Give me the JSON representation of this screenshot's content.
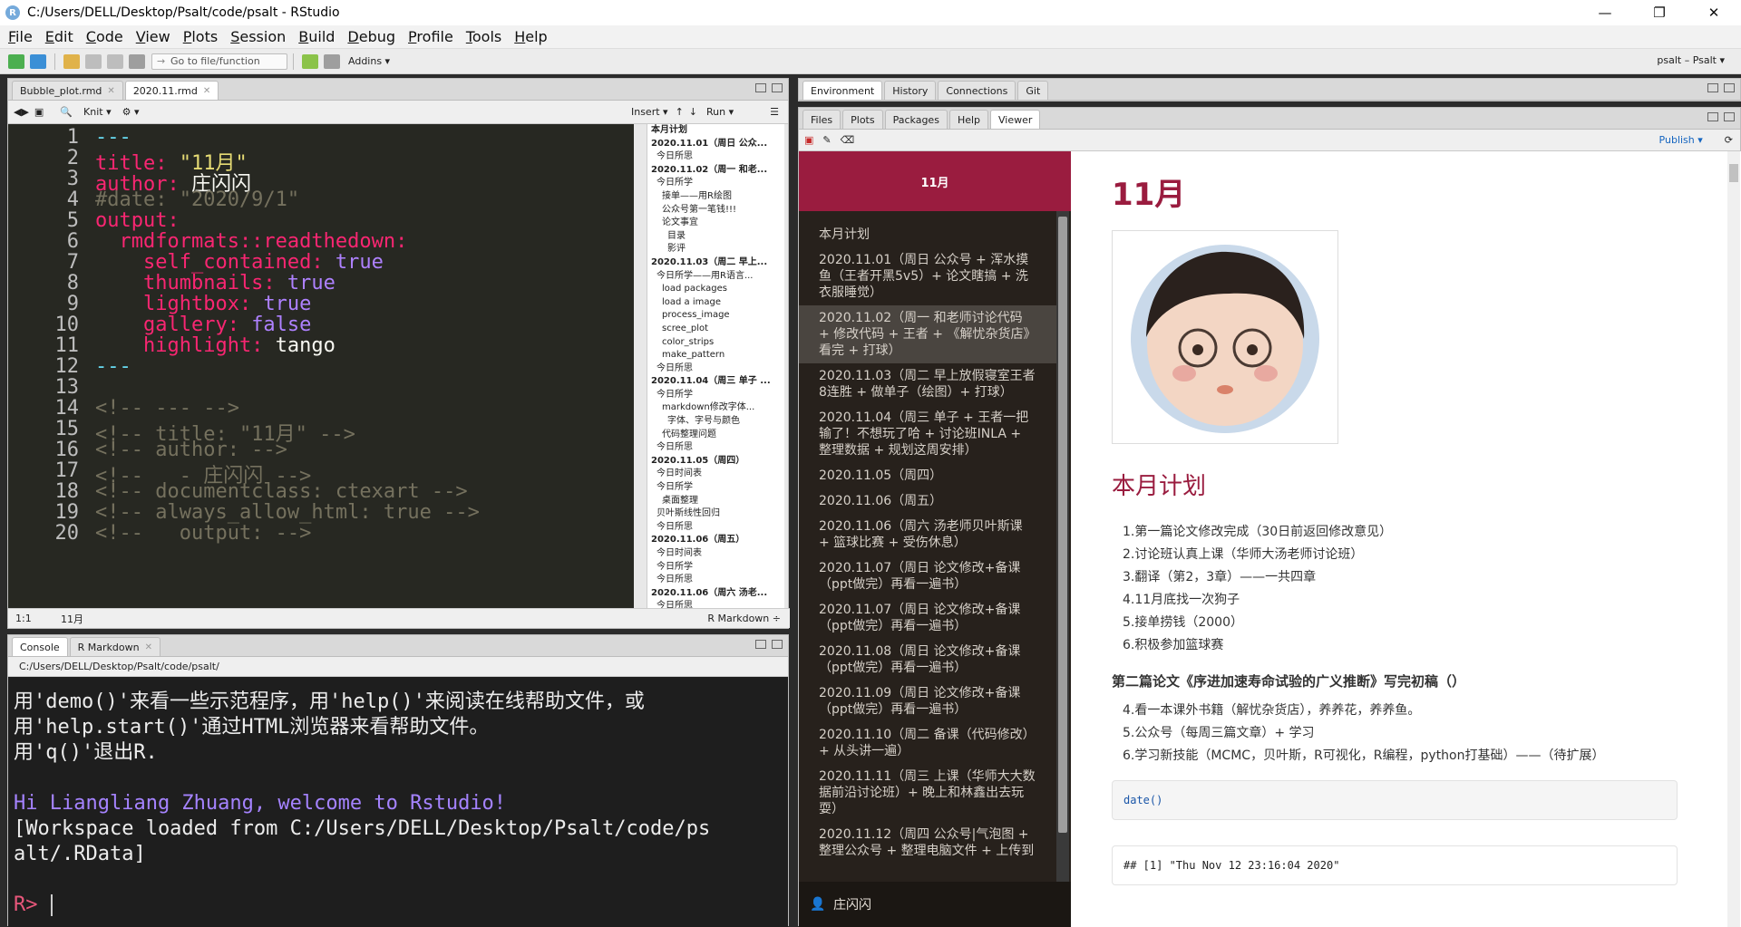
{
  "window": {
    "title": "C:/Users/DELL/Desktop/Psalt/code/psalt - RStudio",
    "controls": [
      "—",
      "❐",
      "✕"
    ]
  },
  "menu": [
    {
      "label": "File",
      "u": "F",
      "rest": "ile"
    },
    {
      "label": "Edit",
      "u": "E",
      "rest": "dit"
    },
    {
      "label": "Code",
      "u": "C",
      "rest": "ode"
    },
    {
      "label": "View",
      "u": "V",
      "rest": "iew"
    },
    {
      "label": "Plots",
      "u": "P",
      "rest": "lots"
    },
    {
      "label": "Session",
      "u": "S",
      "rest": "ession"
    },
    {
      "label": "Build",
      "u": "B",
      "rest": "uild"
    },
    {
      "label": "Debug",
      "u": "D",
      "rest": "ebug"
    },
    {
      "label": "Profile",
      "u": "P",
      "rest": "rofile"
    },
    {
      "label": "Tools",
      "u": "T",
      "rest": "ools"
    },
    {
      "label": "Help",
      "u": "H",
      "rest": "elp"
    }
  ],
  "toolbar": {
    "goto_placeholder": "Go to file/function",
    "addins": "Addins ▾",
    "project": "psalt – Psalt ▾"
  },
  "editor": {
    "tabs": [
      "Bubble_plot.rmd",
      "2020.11.rmd"
    ],
    "toolbar": {
      "knit": "Knit ▾",
      "insert": "Insert ▾",
      "run": "Run ▾"
    },
    "status": {
      "position": "1:1",
      "section": "11月",
      "mode": "R Markdown ÷"
    },
    "lines": [
      {
        "n": "1",
        "spans": [
          {
            "t": "---",
            "c": "#66d9ef"
          }
        ]
      },
      {
        "n": "2",
        "spans": [
          {
            "t": "title: ",
            "c": "#f92672"
          },
          {
            "t": "\"11月\"",
            "c": "#e6db74"
          }
        ]
      },
      {
        "n": "3",
        "spans": [
          {
            "t": "author: ",
            "c": "#f92672"
          },
          {
            "t": "庄闪闪",
            "c": "#f8f8f2"
          }
        ]
      },
      {
        "n": "4",
        "spans": [
          {
            "t": "#date: \"2020/9/1\"",
            "c": "#75715e"
          }
        ]
      },
      {
        "n": "5",
        "spans": [
          {
            "t": "output:",
            "c": "#f92672"
          }
        ]
      },
      {
        "n": "6",
        "spans": [
          {
            "t": "  rmdformats::readthedown:",
            "c": "#f92672"
          }
        ]
      },
      {
        "n": "7",
        "spans": [
          {
            "t": "    self_contained: ",
            "c": "#f92672"
          },
          {
            "t": "true",
            "c": "#ae81ff"
          }
        ]
      },
      {
        "n": "8",
        "spans": [
          {
            "t": "    thumbnails: ",
            "c": "#f92672"
          },
          {
            "t": "true",
            "c": "#ae81ff"
          }
        ]
      },
      {
        "n": "9",
        "spans": [
          {
            "t": "    lightbox: ",
            "c": "#f92672"
          },
          {
            "t": "true",
            "c": "#ae81ff"
          }
        ]
      },
      {
        "n": "10",
        "spans": [
          {
            "t": "    gallery: ",
            "c": "#f92672"
          },
          {
            "t": "false",
            "c": "#ae81ff"
          }
        ]
      },
      {
        "n": "11",
        "spans": [
          {
            "t": "    highlight: ",
            "c": "#f92672"
          },
          {
            "t": "tango",
            "c": "#f8f8f2"
          }
        ]
      },
      {
        "n": "12",
        "spans": [
          {
            "t": "---",
            "c": "#66d9ef"
          }
        ]
      },
      {
        "n": "13",
        "spans": []
      },
      {
        "n": "14",
        "spans": [
          {
            "t": "<!-- --- -->",
            "c": "#75715e"
          }
        ]
      },
      {
        "n": "15",
        "spans": [
          {
            "t": "<!-- title: \"11月\" -->",
            "c": "#75715e"
          }
        ]
      },
      {
        "n": "16",
        "spans": [
          {
            "t": "<!-- author: -->",
            "c": "#75715e"
          }
        ]
      },
      {
        "n": "17",
        "spans": [
          {
            "t": "<!--   - 庄闪闪 -->",
            "c": "#75715e"
          }
        ]
      },
      {
        "n": "18",
        "spans": [
          {
            "t": "<!-- documentclass: ctexart -->",
            "c": "#75715e"
          }
        ]
      },
      {
        "n": "19",
        "spans": [
          {
            "t": "<!-- always_allow_html: true -->",
            "c": "#75715e"
          }
        ]
      },
      {
        "n": "20",
        "spans": [
          {
            "t": "<!--   output: -->",
            "c": "#75715e"
          }
        ]
      }
    ],
    "outline": [
      {
        "t": "本月计划",
        "l": 0
      },
      {
        "t": "2020.11.01（周日 公众...",
        "l": 0
      },
      {
        "t": "今日所思",
        "l": 1
      },
      {
        "t": "2020.11.02（周一 和老...",
        "l": 0
      },
      {
        "t": "今日所学",
        "l": 1
      },
      {
        "t": "接单——用R绘图",
        "l": 2
      },
      {
        "t": "公众号第一笔钱!!!",
        "l": 2
      },
      {
        "t": "论文事宜",
        "l": 2
      },
      {
        "t": "目录",
        "l": 3
      },
      {
        "t": "影评",
        "l": 3
      },
      {
        "t": "2020.11.03（周二 早上...",
        "l": 0
      },
      {
        "t": "今日所学——用R语言...",
        "l": 1
      },
      {
        "t": "load packages",
        "l": 2
      },
      {
        "t": "load a image",
        "l": 2
      },
      {
        "t": "process_image",
        "l": 2
      },
      {
        "t": "scree_plot",
        "l": 2
      },
      {
        "t": "color_strips",
        "l": 2
      },
      {
        "t": "make_pattern",
        "l": 2
      },
      {
        "t": "今日所思",
        "l": 1
      },
      {
        "t": "2020.11.04（周三 单子 ...",
        "l": 0
      },
      {
        "t": "今日所学",
        "l": 1
      },
      {
        "t": "markdown修改字体...",
        "l": 2
      },
      {
        "t": "字体、字号与颜色",
        "l": 3
      },
      {
        "t": "代码整理问题",
        "l": 2
      },
      {
        "t": "今日所思",
        "l": 1
      },
      {
        "t": "2020.11.05（周四）",
        "l": 0
      },
      {
        "t": "今日时间表",
        "l": 1
      },
      {
        "t": "今日所学",
        "l": 1
      },
      {
        "t": "桌面整理",
        "l": 2
      },
      {
        "t": "贝叶斯线性回归",
        "l": 1
      },
      {
        "t": "今日所思",
        "l": 1
      },
      {
        "t": "2020.11.06（周五）",
        "l": 0
      },
      {
        "t": "今日时间表",
        "l": 1
      },
      {
        "t": "今日所学",
        "l": 1
      },
      {
        "t": "今日所思",
        "l": 1
      },
      {
        "t": "2020.11.06（周六 汤老...",
        "l": 0
      },
      {
        "t": "今日所思",
        "l": 1
      }
    ]
  },
  "console": {
    "tabs": [
      "Console",
      "R Markdown"
    ],
    "path": "C:/Users/DELL/Desktop/Psalt/code/psalt/",
    "lines": [
      {
        "t": "用'demo()'来看一些示范程序，用'help()'来阅读在线帮助文件，或",
        "c": "#ececec"
      },
      {
        "t": "用'help.start()'通过HTML浏览器来看帮助文件。",
        "c": "#ececec"
      },
      {
        "t": "用'q()'退出R.",
        "c": "#ececec"
      },
      {
        "t": " ",
        "c": "#ececec"
      },
      {
        "t": "Hi Liangliang Zhuang, welcome to Rstudio!",
        "c": "#a583ff"
      },
      {
        "t": "[Workspace loaded from C:/Users/DELL/Desktop/Psalt/code/ps",
        "c": "#ececec"
      },
      {
        "t": "alt/.RData]",
        "c": "#ececec"
      },
      {
        "t": " ",
        "c": "#ececec"
      }
    ],
    "prompt": "R>"
  },
  "env_tabs": [
    "Environment",
    "History",
    "Connections",
    "Git"
  ],
  "viewer": {
    "tabs": [
      "Files",
      "Plots",
      "Packages",
      "Help",
      "Viewer"
    ],
    "publish": "Publish ▾",
    "side_title": "11月",
    "nav": [
      "本月计划",
      "2020.11.01（周日 公众号 + 浑水摸鱼（王者开黑5v5）+ 论文瞎搞 + 洗衣服睡觉）",
      "2020.11.02（周一 和老师讨论代码 + 修改代码 + 王者 + 《解忧杂货店》看完 + 打球）",
      "2020.11.03（周二 早上放假寝室王者8连胜 + 做单子（绘图）+ 打球）",
      "2020.11.04（周三 单子 + 王者一把输了！不想玩了哈 + 讨论班INLA + 整理数据 + 规划这周安排）",
      "2020.11.05（周四）",
      "2020.11.06（周五）",
      "2020.11.06（周六 汤老师贝叶斯课 + 篮球比赛 + 受伤休息）",
      "2020.11.07（周日 论文修改+备课（ppt做完）再看一遍书）",
      "2020.11.07（周日 论文修改+备课（ppt做完）再看一遍书）",
      "2020.11.08（周日 论文修改+备课（ppt做完）再看一遍书）",
      "2020.11.09（周日 论文修改+备课（ppt做完）再看一遍书）",
      "2020.11.10（周二 备课（代码修改）+ 从头讲一遍）",
      "2020.11.11（周三 上课（华师大大数据前沿讨论班）+ 晚上和林鑫出去玩耍）",
      "2020.11.12（周四 公众号|气泡图 + 整理公众号 + 整理电脑文件 + 上传到"
    ],
    "active_nav": 2,
    "author": "庄闪闪",
    "doc_title": "11月",
    "section_title": "本月计划",
    "plan": [
      "1.第一篇论文修改完成（30日前返回修改意见）",
      "2.讨论班认真上课（华师大汤老师讨论班）",
      "3.翻译（第2，3章）——一共四章",
      "4.11月底找一次狗子",
      "5.接单捞钱（2000）",
      "6.积极参加篮球赛"
    ],
    "subheading": "第二篇论文《序进加速寿命试验的广义推断》写完初稿（）",
    "plan2": [
      "4.看一本课外书籍（解忧杂货店），养养花，养养鱼。",
      "5.公众号（每周三篇文章）+ 学习",
      "6.学习新技能（MCMC，贝叶斯，R可视化，R编程，python打基础）——（待扩展）"
    ],
    "code": "date()",
    "output": "## [1] \"Thu Nov 12 23:16:04 2020\""
  }
}
